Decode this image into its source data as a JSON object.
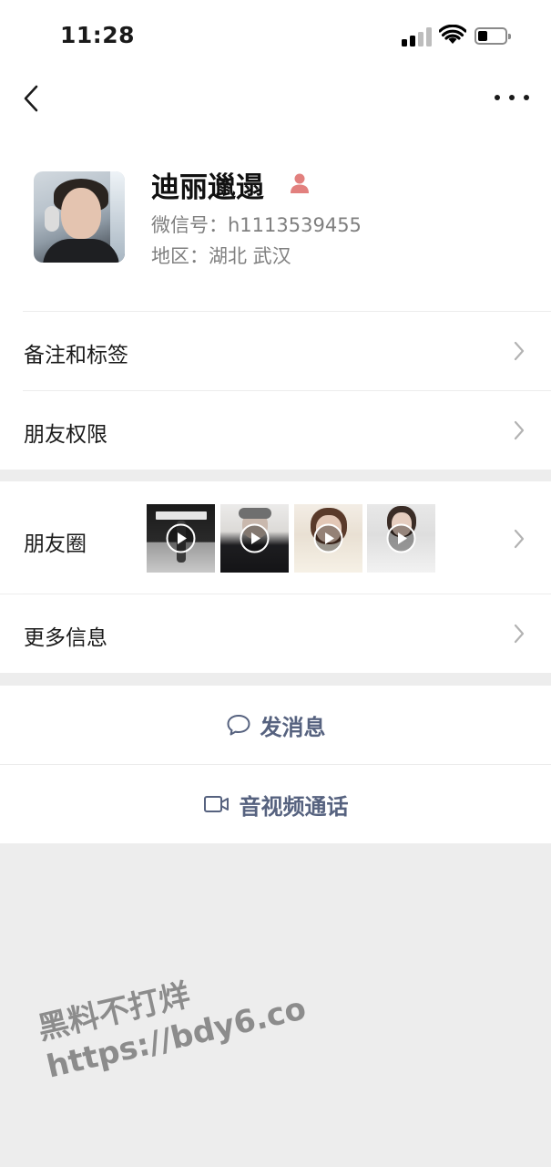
{
  "status_bar": {
    "time": "11:28"
  },
  "profile": {
    "name": "迪丽邋遢",
    "wechat_id": "微信号：h1113539455",
    "region": "地区：湖北 武汉"
  },
  "rows": {
    "remarks": "备注和标签",
    "permissions": "朋友权限",
    "moments": "朋友圈",
    "more_info": "更多信息"
  },
  "actions": {
    "message": "发消息",
    "call": "音视频通话"
  },
  "watermark": {
    "line1": "黑料不打烊",
    "line2": "https://bdy6.co"
  },
  "colors": {
    "accent": "#56627f",
    "person_icon": "#e2807e",
    "background": "#ededed"
  },
  "icons": [
    "back-icon",
    "more-icon",
    "person-icon",
    "chevron-right-icon",
    "play-icon",
    "message-icon",
    "video-call-icon"
  ]
}
